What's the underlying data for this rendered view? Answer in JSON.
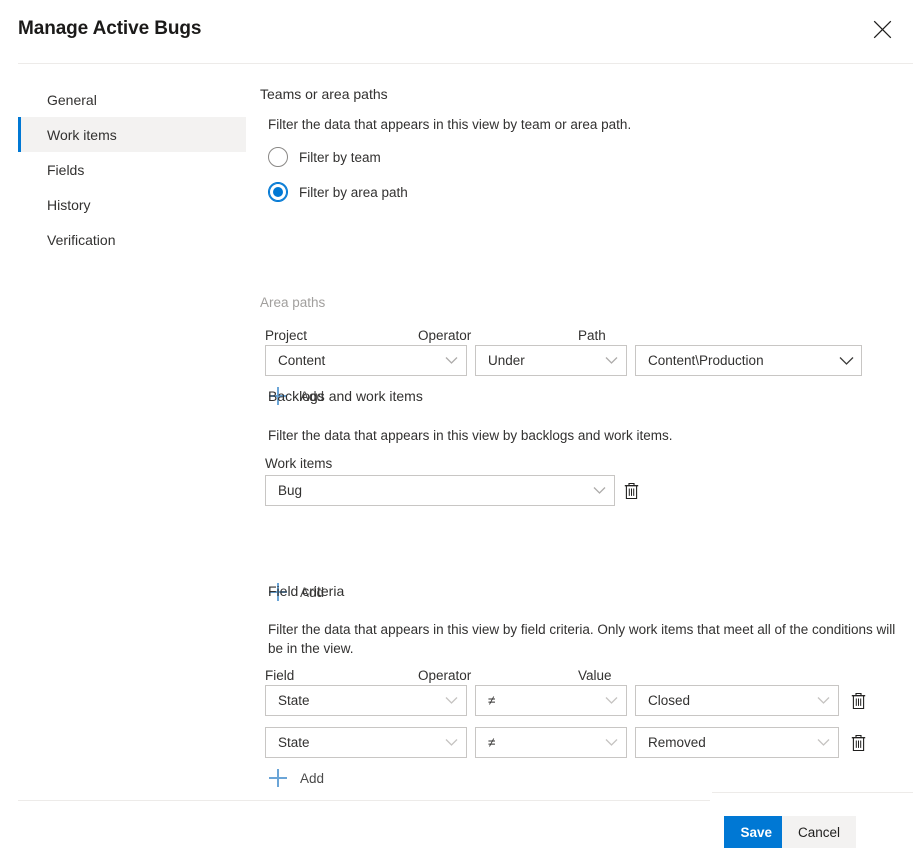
{
  "dialog": {
    "title": "Manage Active Bugs",
    "close_icon": "close-icon"
  },
  "nav": {
    "items": [
      {
        "label": "General",
        "selected": false
      },
      {
        "label": "Work items",
        "selected": true
      },
      {
        "label": "Fields",
        "selected": false
      },
      {
        "label": "History",
        "selected": false
      },
      {
        "label": "Verification",
        "selected": false
      }
    ]
  },
  "teams_section": {
    "title": "Teams or area paths",
    "description": "Filter the data that appears in this view by team or area path.",
    "options": [
      {
        "label": "Filter by team",
        "selected": false
      },
      {
        "label": "Filter by area path",
        "selected": true
      }
    ]
  },
  "area_paths": {
    "title": "Area paths",
    "columns": {
      "project": "Project",
      "operator": "Operator",
      "path": "Path"
    },
    "rows": [
      {
        "project": "Content",
        "operator": "Under",
        "path": "Content\\Production"
      }
    ],
    "add_label": "Add"
  },
  "backlogs_section": {
    "title": "Backlogs and work items",
    "description": "Filter the data that appears in this view by backlogs and work items.",
    "label": "Work items",
    "rows": [
      {
        "value": "Bug"
      }
    ],
    "add_label": "Add",
    "delete_icon": "trash-icon"
  },
  "field_criteria": {
    "title": "Field criteria",
    "description": "Filter the data that appears in this view by field criteria. Only work items that meet all of the conditions will be in the view.",
    "columns": {
      "field": "Field",
      "operator": "Operator",
      "value": "Value"
    },
    "rows": [
      {
        "field": "State",
        "operator": "≠",
        "value": "Closed"
      },
      {
        "field": "State",
        "operator": "≠",
        "value": "Removed"
      }
    ],
    "add_label": "Add",
    "delete_icon": "trash-icon"
  },
  "footer": {
    "save_label": "Save",
    "cancel_label": "Cancel"
  },
  "colors": {
    "accent": "#0078d4",
    "selected_nav_bg": "#f3f2f1",
    "border": "#c8c6c4",
    "divider": "#edebe9",
    "add_plus": "#6ba5d7",
    "muted_text": "#a19f9d",
    "text": "#323130"
  }
}
